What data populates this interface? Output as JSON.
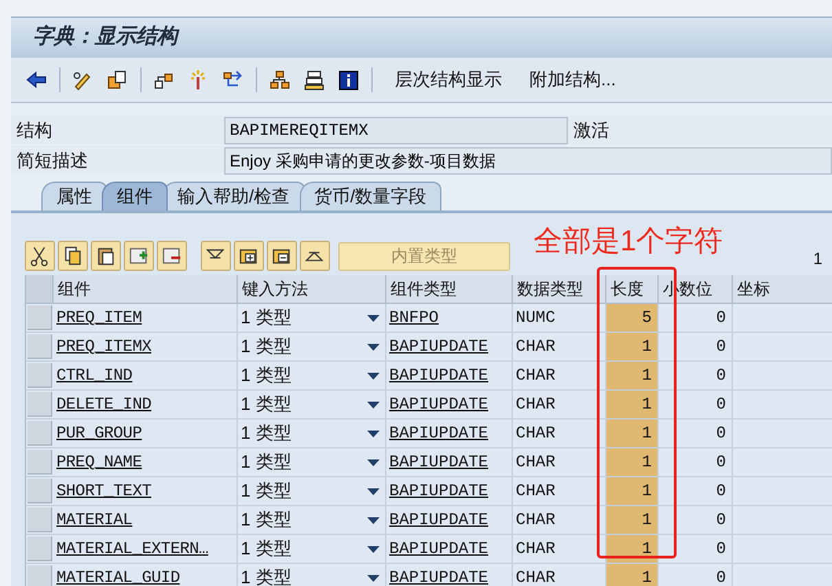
{
  "window": {
    "title": "字典：显示结构"
  },
  "toolbar": {
    "buttons": [
      "层次结构显示",
      "附加结构..."
    ]
  },
  "fields": [
    {
      "label": "结构",
      "value": "BAPIMEREQITEMX",
      "status": "激活"
    },
    {
      "label": "简短描述",
      "value": "Enjoy 采购申请的更改参数-项目数据"
    }
  ],
  "tabs": [
    {
      "label": "属性",
      "selected": false
    },
    {
      "label": "组件",
      "selected": true
    },
    {
      "label": "输入帮助/检查",
      "selected": false
    },
    {
      "label": "货币/数量字段",
      "selected": false
    }
  ],
  "table_toolbar": {
    "button": "内置类型",
    "count": "1"
  },
  "table": {
    "columns": [
      "组件",
      "键入方法",
      "组件类型",
      "数据类型",
      "长度",
      "小数位",
      "坐标"
    ],
    "rows": [
      {
        "component": "PREQ_ITEM",
        "entry_method": "1 类型",
        "component_type": "BNFPO",
        "data_type": "NUMC",
        "length": "5",
        "decimals": "0"
      },
      {
        "component": "PREQ_ITEMX",
        "entry_method": "1 类型",
        "component_type": "BAPIUPDATE",
        "data_type": "CHAR",
        "length": "1",
        "decimals": "0"
      },
      {
        "component": "CTRL_IND",
        "entry_method": "1 类型",
        "component_type": "BAPIUPDATE",
        "data_type": "CHAR",
        "length": "1",
        "decimals": "0"
      },
      {
        "component": "DELETE_IND",
        "entry_method": "1 类型",
        "component_type": "BAPIUPDATE",
        "data_type": "CHAR",
        "length": "1",
        "decimals": "0"
      },
      {
        "component": "PUR_GROUP",
        "entry_method": "1 类型",
        "component_type": "BAPIUPDATE",
        "data_type": "CHAR",
        "length": "1",
        "decimals": "0"
      },
      {
        "component": "PREQ_NAME",
        "entry_method": "1 类型",
        "component_type": "BAPIUPDATE",
        "data_type": "CHAR",
        "length": "1",
        "decimals": "0"
      },
      {
        "component": "SHORT_TEXT",
        "entry_method": "1 类型",
        "component_type": "BAPIUPDATE",
        "data_type": "CHAR",
        "length": "1",
        "decimals": "0"
      },
      {
        "component": "MATERIAL",
        "entry_method": "1 类型",
        "component_type": "BAPIUPDATE",
        "data_type": "CHAR",
        "length": "1",
        "decimals": "0"
      },
      {
        "component": "MATERIAL_EXTERN…",
        "entry_method": "1 类型",
        "component_type": "BAPIUPDATE",
        "data_type": "CHAR",
        "length": "1",
        "decimals": "0"
      },
      {
        "component": "MATERIAL_GUID",
        "entry_method": "1 类型",
        "component_type": "BAPIUPDATE",
        "data_type": "CHAR",
        "length": "1",
        "decimals": "0"
      }
    ]
  },
  "annotation": {
    "text": "全部是1个字符"
  }
}
